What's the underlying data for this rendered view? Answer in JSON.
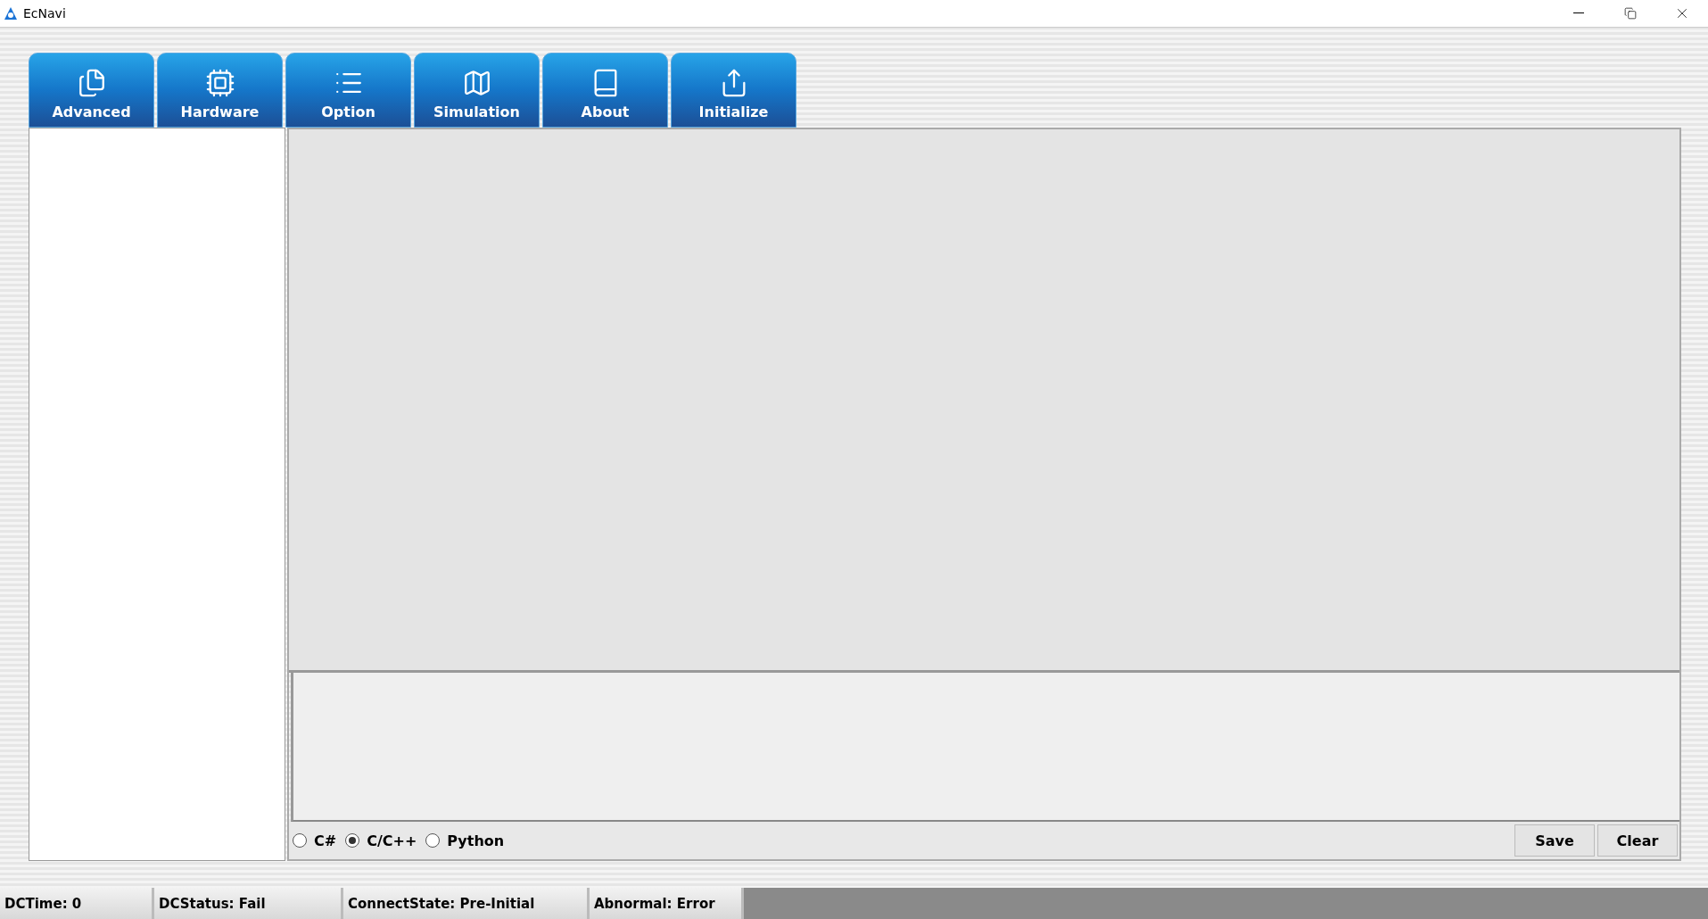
{
  "window": {
    "title": "EcNavi"
  },
  "tabs": [
    {
      "label": "Advanced",
      "kind": "document"
    },
    {
      "label": "Hardware",
      "kind": "chip"
    },
    {
      "label": "Option",
      "kind": "list"
    },
    {
      "label": "Simulation",
      "kind": "map"
    },
    {
      "label": "About",
      "kind": "book"
    },
    {
      "label": "Initialize",
      "kind": "share"
    }
  ],
  "language_options": [
    {
      "label": "C#",
      "selected": false
    },
    {
      "label": "C/C++",
      "selected": true
    },
    {
      "label": "Python",
      "selected": false
    }
  ],
  "buttons": [
    "Save",
    "Clear"
  ],
  "status_bar": [
    "DCTime: 0",
    "DCStatus: Fail",
    "ConnectState: Pre-Initial",
    "Abnormal: Error"
  ]
}
